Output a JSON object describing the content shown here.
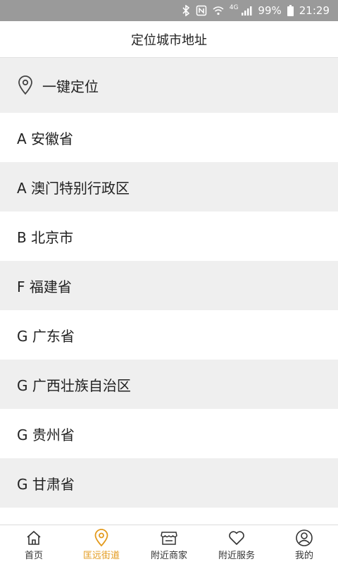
{
  "status_bar": {
    "network": "4G",
    "battery": "99%",
    "time": "21:29"
  },
  "header": {
    "title": "定位城市地址"
  },
  "locate": {
    "label": "一键定位",
    "icon": "location-pin-icon"
  },
  "provinces": [
    {
      "label": "A 安徽省"
    },
    {
      "label": "A 澳门特别行政区"
    },
    {
      "label": "B 北京市"
    },
    {
      "label": "F 福建省"
    },
    {
      "label": "G 广东省"
    },
    {
      "label": "G 广西壮族自治区"
    },
    {
      "label": "G 贵州省"
    },
    {
      "label": "G 甘肃省"
    }
  ],
  "tabs": [
    {
      "label": "首页",
      "icon": "home-icon",
      "active": false
    },
    {
      "label": "匡远街道",
      "icon": "location-pin-icon",
      "active": true
    },
    {
      "label": "附近商家",
      "icon": "store-icon",
      "active": false
    },
    {
      "label": "附近服务",
      "icon": "heart-icon",
      "active": false
    },
    {
      "label": "我的",
      "icon": "user-icon",
      "active": false
    }
  ],
  "colors": {
    "accent": "#e39a1c",
    "status_bar": "#9a9a9a",
    "row_alt": "#efefef"
  }
}
